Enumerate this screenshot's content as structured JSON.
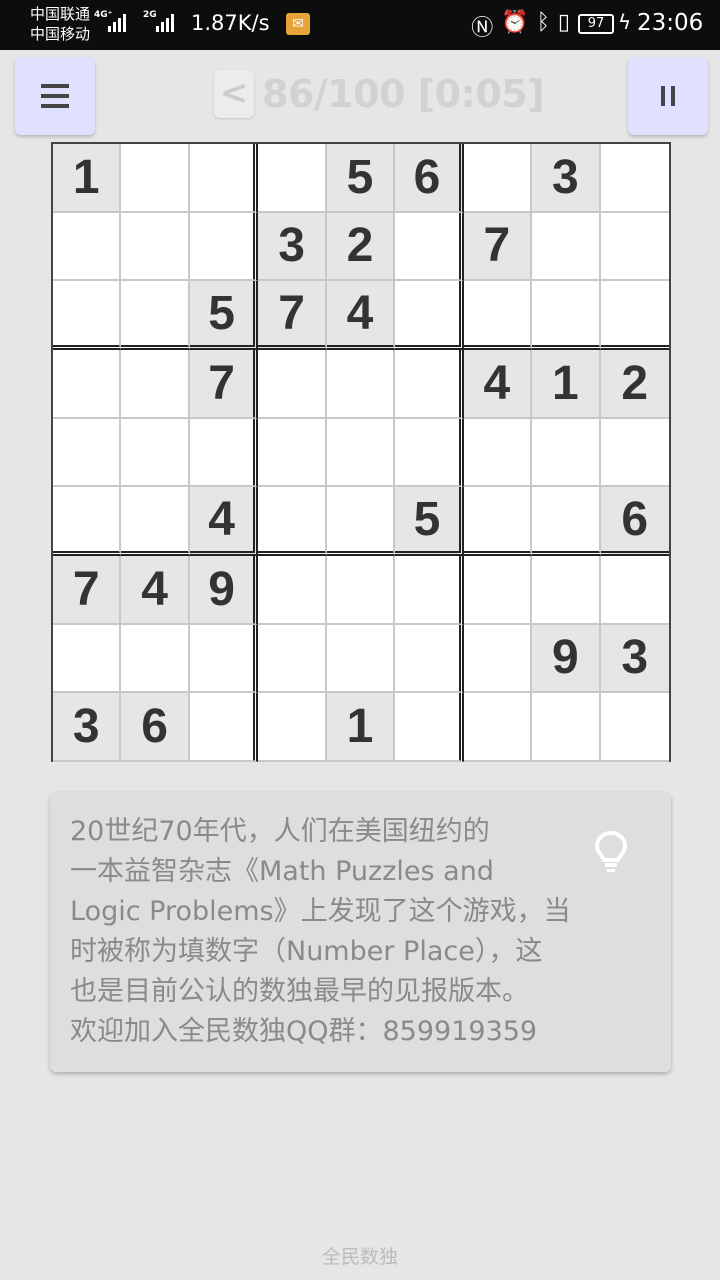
{
  "status_bar": {
    "carrier1": "中国联通",
    "carrier2": "中国移动",
    "net1": "4G⁺",
    "net2": "2G",
    "speed": "1.87K/s",
    "battery": "97",
    "time": "23:06"
  },
  "header": {
    "prev_label": "<",
    "progress": "86/100 [0:05]"
  },
  "grid": [
    [
      "1",
      "",
      "",
      "",
      "5",
      "6",
      "",
      "3",
      ""
    ],
    [
      "",
      "",
      "",
      "3",
      "2",
      "",
      "7",
      "",
      ""
    ],
    [
      "",
      "",
      "5",
      "7",
      "4",
      "",
      "",
      "",
      ""
    ],
    [
      "",
      "",
      "7",
      "",
      "",
      "",
      "4",
      "1",
      "2"
    ],
    [
      "",
      "",
      "",
      "",
      "",
      "",
      "",
      "",
      ""
    ],
    [
      "",
      "",
      "4",
      "",
      "",
      "5",
      "",
      "",
      "6"
    ],
    [
      "7",
      "4",
      "9",
      "",
      "",
      "",
      "",
      "",
      ""
    ],
    [
      "",
      "",
      "",
      "",
      "",
      "",
      "",
      "9",
      "3"
    ],
    [
      "3",
      "6",
      "",
      "",
      "1",
      "",
      "",
      "",
      ""
    ]
  ],
  "tip": {
    "text": "20世纪70年代，人们在美国纽约的一本益智杂志《Math Puzzles and Logic Problems》上发现了这个游戏，当时被称为填数字（Number Place），这也是目前公认的数独最早的见报版本。欢迎加入全民数独QQ群：859919359",
    "line1": "20世纪70年代，人们在美国纽约的",
    "line2": "一本益智杂志《Math Puzzles and",
    "line3": "Logic Problems》上发现了这个游戏，当",
    "line4": "时被称为填数字（Number Place），这",
    "line5": "也是目前公认的数独最早的见报版本。",
    "line6": "欢迎加入全民数独QQ群：859919359",
    "icon": "lightbulb-icon"
  },
  "footer": {
    "app_name": "全民数独"
  },
  "colors": {
    "button_bg": "#e0e0ff",
    "given_cell_bg": "#e6e6e6",
    "digit": "#333333"
  }
}
